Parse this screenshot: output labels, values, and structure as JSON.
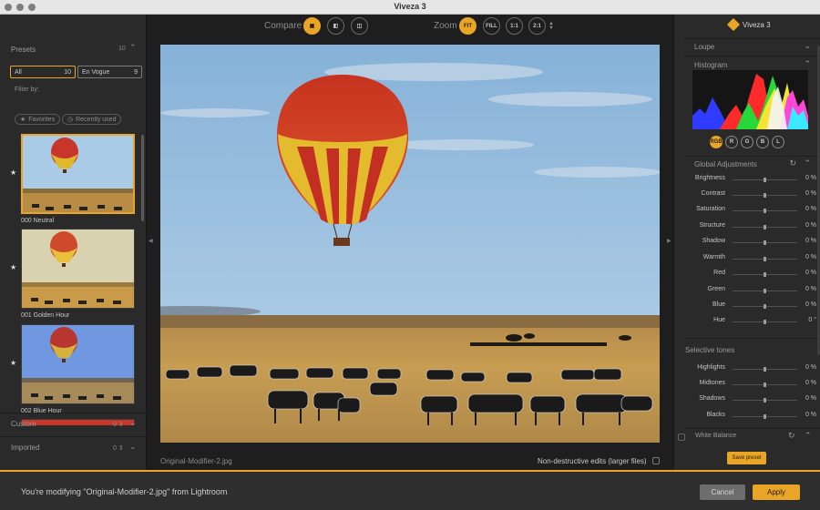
{
  "window": {
    "title": "Viveza 3"
  },
  "colors": {
    "accent": "#e9a526"
  },
  "presets": {
    "title": "Presets",
    "count": "10",
    "filters": [
      {
        "label": "All",
        "count": "10"
      },
      {
        "label": "En Vogue",
        "count": "9"
      }
    ],
    "filter_by": "Filter by:",
    "pills": [
      "Favorites",
      "Recently used"
    ],
    "items": [
      {
        "label": "000 Neutral"
      },
      {
        "label": "001 Golden Hour"
      },
      {
        "label": "002 Blue Hour"
      }
    ]
  },
  "sections": {
    "custom": {
      "label": "Custom",
      "count": "0"
    },
    "imported": {
      "label": "Imported",
      "count": "0"
    }
  },
  "toolbar": {
    "compare_label": "Compare",
    "zoom_label": "Zoom",
    "zoom_buttons": [
      "FIT",
      "FILL",
      "1:1",
      "2:1"
    ]
  },
  "image": {
    "filename": "Original-Modifier-2.jpg",
    "nondestructive_label": "Non-destructive edits (larger files)"
  },
  "right": {
    "brand": "Viveza 3",
    "loupe": "Loupe",
    "histogram": "Histogram",
    "channels": [
      "RGB",
      "R",
      "G",
      "B",
      "L"
    ],
    "global_title": "Global Adjustments",
    "global": [
      {
        "name": "Brightness",
        "value": "0 %"
      },
      {
        "name": "Contrast",
        "value": "0 %"
      },
      {
        "name": "Saturation",
        "value": "0 %"
      },
      {
        "name": "Structure",
        "value": "0 %"
      },
      {
        "name": "Shadow",
        "value": "0 %"
      },
      {
        "name": "Warmth",
        "value": "0 %"
      },
      {
        "name": "Red",
        "value": "0 %"
      },
      {
        "name": "Green",
        "value": "0 %"
      },
      {
        "name": "Blue",
        "value": "0 %"
      },
      {
        "name": "Hue",
        "value": "0 °"
      }
    ],
    "selective_title": "Selective tones",
    "selective": [
      {
        "name": "Highlights",
        "value": "0 %"
      },
      {
        "name": "Midtones",
        "value": "0 %"
      },
      {
        "name": "Shadows",
        "value": "0 %"
      },
      {
        "name": "Blacks",
        "value": "0 %"
      }
    ],
    "white_balance": "White Balance",
    "save_preset": "Save preset"
  },
  "bottom": {
    "message": "You're modifying \"Original-Modifier-2.jpg\" from Lightroom",
    "cancel": "Cancel",
    "apply": "Apply"
  }
}
